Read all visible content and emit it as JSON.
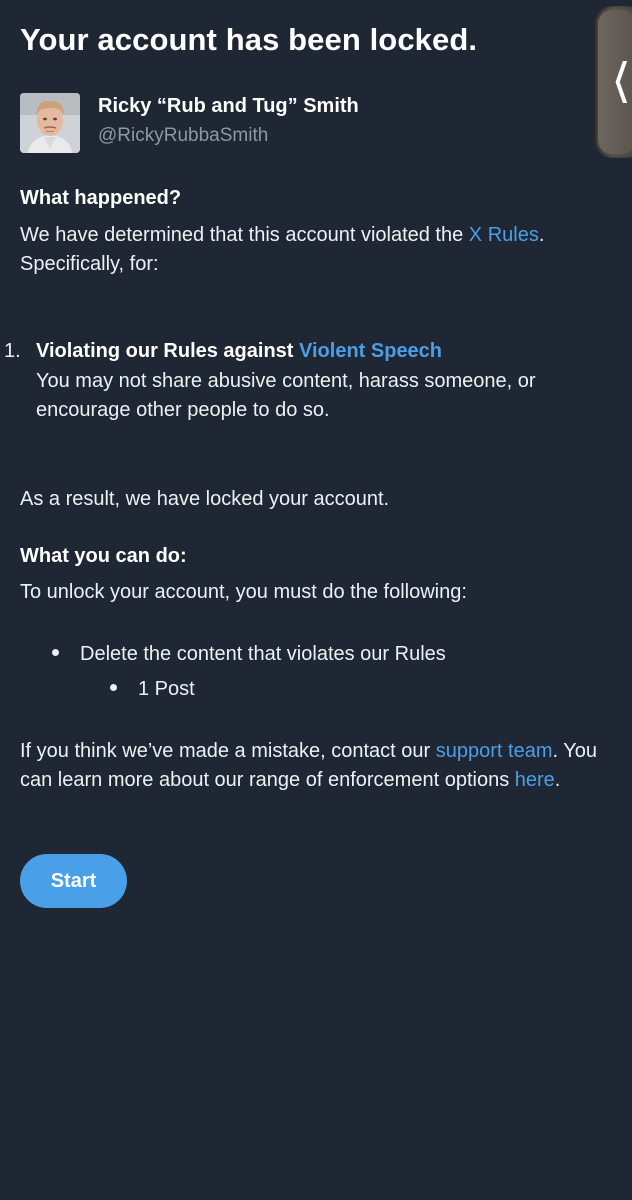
{
  "header": {
    "title": "Your account has been locked."
  },
  "side_tab": {
    "icon": "chevron-left-icon",
    "glyph": "❬"
  },
  "profile": {
    "display_name": "Ricky “Rub and Tug” Smith",
    "handle": "@RickyRubbaSmith"
  },
  "what_happened": {
    "heading": "What happened?",
    "text_before_link": "We have determined that this account violated the ",
    "rules_link": "X Rules",
    "text_after_link": ". Specifically, for:"
  },
  "violation": {
    "number": "1.",
    "title_prefix": "Violating our Rules against ",
    "policy_link": "Violent Speech",
    "description": "You may not share abusive content, harass someone, or encourage other people to do so."
  },
  "result": {
    "text": "As a result, we have locked your account."
  },
  "what_you_can_do": {
    "heading": "What you can do:",
    "intro": "To unlock your account, you must do the following:",
    "step": "Delete the content that violates our Rules",
    "sub_item": "1 Post"
  },
  "mistake": {
    "text_1": "If you think we’ve made a mistake, contact our ",
    "support_link": "support team",
    "text_2": ". You can learn more about our range of enforcement options ",
    "here_link": "here",
    "text_3": "."
  },
  "actions": {
    "start_label": "Start"
  },
  "colors": {
    "background": "#1e2733",
    "link": "#4c9fe6",
    "button": "#4aa0e8",
    "secondary_text": "#8b98a5"
  }
}
